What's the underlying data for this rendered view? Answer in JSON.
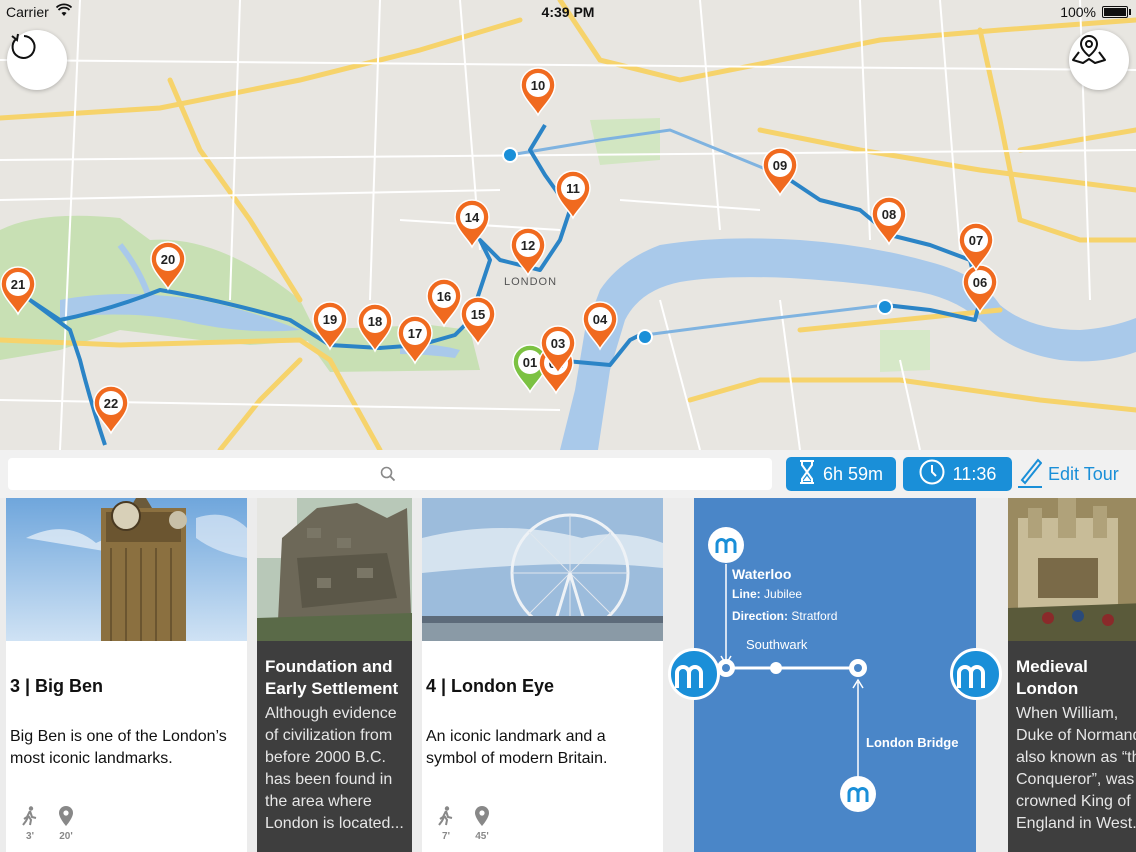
{
  "status_bar": {
    "carrier": "Carrier",
    "time": "4:39 PM",
    "battery": "100%"
  },
  "map": {
    "area_label": "LONDON",
    "stops": [
      {
        "label": "01",
        "color": "#7cc242"
      },
      {
        "label": "02",
        "color": "#f06a1f"
      },
      {
        "label": "03",
        "color": "#f06a1f"
      },
      {
        "label": "04",
        "color": "#f06a1f"
      },
      {
        "label": "06",
        "color": "#f06a1f"
      },
      {
        "label": "07",
        "color": "#f06a1f"
      },
      {
        "label": "08",
        "color": "#f06a1f"
      },
      {
        "label": "09",
        "color": "#f06a1f"
      },
      {
        "label": "10",
        "color": "#f06a1f"
      },
      {
        "label": "11",
        "color": "#f06a1f"
      },
      {
        "label": "12",
        "color": "#f06a1f"
      },
      {
        "label": "14",
        "color": "#f06a1f"
      },
      {
        "label": "15",
        "color": "#f06a1f"
      },
      {
        "label": "16",
        "color": "#f06a1f"
      },
      {
        "label": "17",
        "color": "#f06a1f"
      },
      {
        "label": "18",
        "color": "#f06a1f"
      },
      {
        "label": "19",
        "color": "#f06a1f"
      },
      {
        "label": "20",
        "color": "#f06a1f"
      },
      {
        "label": "21",
        "color": "#f06a1f"
      },
      {
        "label": "22",
        "color": "#f06a1f"
      }
    ],
    "route_color": "#2b84c6",
    "water_color": "#a9c9ea",
    "park_color": "#c8e0b4"
  },
  "toolbar": {
    "search_placeholder": "",
    "duration": "6h 59m",
    "time": "11:36",
    "edit_label": "Edit Tour",
    "accent": "#1a8fd8"
  },
  "cards": {
    "big_ben": {
      "title": "3 | Big Ben",
      "desc": "Big Ben is one of the London’s most iconic landmarks.",
      "walk": "3'",
      "distance": "20'"
    },
    "foundation": {
      "title": "Foundation and Early Settlement",
      "desc": "Although evidence of civilization from before 2000 B.C. has been found in the area where London is located..."
    },
    "london_eye": {
      "title": "4 | London Eye",
      "desc": "An iconic landmark and a symbol of modern Britain.",
      "walk": "7'",
      "distance": "45'"
    },
    "transit": {
      "from_station": "Waterloo",
      "line_label": "Line:",
      "line_value": "Jubilee",
      "direction_label": "Direction:",
      "direction_value": "Stratford",
      "via_station": "Southwark",
      "to_station": "London Bridge",
      "metro_glyph": "m"
    },
    "medieval": {
      "title": "Medieval London",
      "desc": "When William, Duke of Normandy, also known as “the Conqueror”, was crowned King of England in West..."
    }
  }
}
